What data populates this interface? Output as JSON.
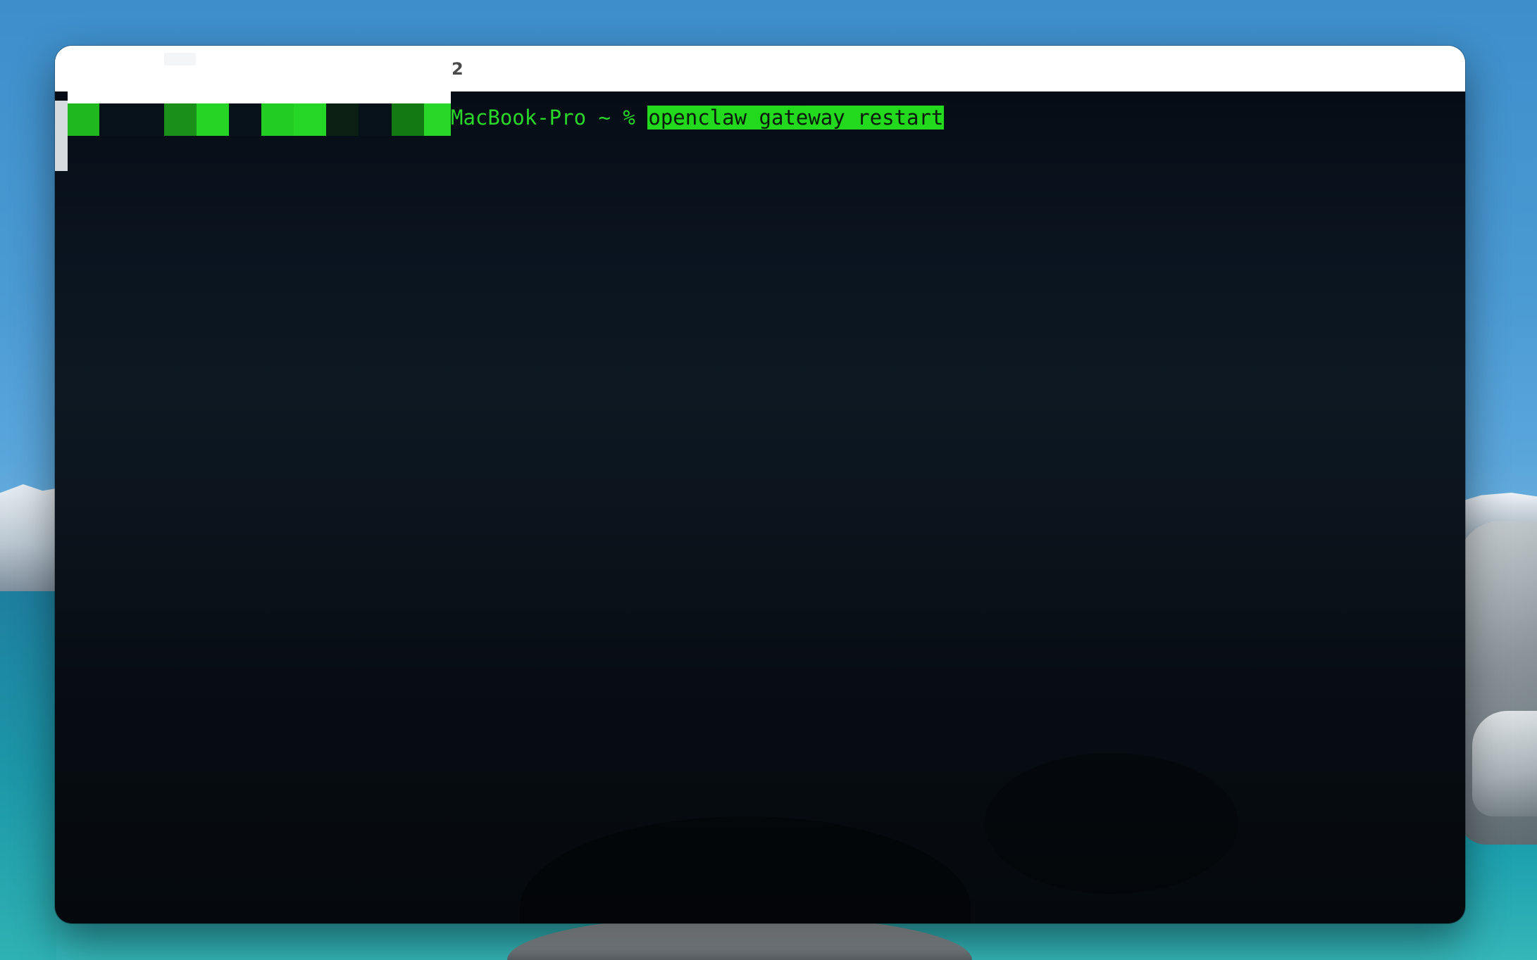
{
  "window": {
    "title_fragment": "2"
  },
  "terminal": {
    "prompt_host": "MacBook-Pro ~ % ",
    "command": "openclaw gateway restart"
  },
  "colors": {
    "terminal_green": "#29d829",
    "command_highlight": "#22d91e",
    "terminal_background": "#0a141f",
    "titlebar": "#ffffff"
  }
}
